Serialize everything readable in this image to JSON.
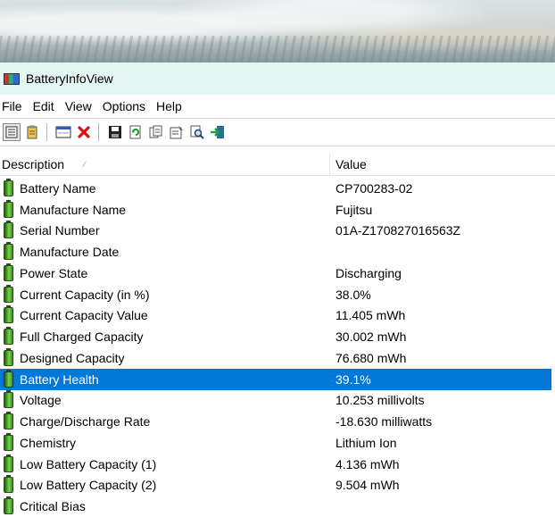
{
  "window": {
    "title": "BatteryInfoView"
  },
  "menu": [
    "File",
    "Edit",
    "View",
    "Options",
    "Help"
  ],
  "toolbar": [
    {
      "icon": "list-view-icon",
      "glyph": "☰",
      "pressed": true
    },
    {
      "icon": "clipboard-icon",
      "glyph": "📋",
      "pressed": false
    },
    {
      "icon": "window-icon",
      "glyph": "▭",
      "pressed": false
    },
    {
      "icon": "delete-icon",
      "glyph": "✕",
      "pressed": false
    },
    {
      "icon": "save-icon",
      "glyph": "💾",
      "pressed": false
    },
    {
      "icon": "refresh-icon",
      "glyph": "⟳",
      "pressed": false
    },
    {
      "icon": "copy-icon",
      "glyph": "⧉",
      "pressed": false
    },
    {
      "icon": "properties-icon",
      "glyph": "🗎",
      "pressed": false
    },
    {
      "icon": "find-icon",
      "glyph": "🔍",
      "pressed": false
    },
    {
      "icon": "exit-icon",
      "glyph": "⇥",
      "pressed": false
    }
  ],
  "columns": {
    "description": "Description",
    "value": "Value"
  },
  "rows": [
    {
      "description": "Battery Name",
      "value": "CP700283-02"
    },
    {
      "description": "Manufacture Name",
      "value": "Fujitsu"
    },
    {
      "description": "Serial Number",
      "value": "01A-Z170827016563Z"
    },
    {
      "description": "Manufacture Date",
      "value": ""
    },
    {
      "description": "Power State",
      "value": "Discharging"
    },
    {
      "description": "Current Capacity (in %)",
      "value": "38.0%"
    },
    {
      "description": "Current Capacity Value",
      "value": "11.405 mWh"
    },
    {
      "description": "Full Charged Capacity",
      "value": "30.002 mWh"
    },
    {
      "description": "Designed Capacity",
      "value": "76.680 mWh"
    },
    {
      "description": "Battery Health",
      "value": "39.1%",
      "selected": true
    },
    {
      "description": "Voltage",
      "value": "10.253 millivolts"
    },
    {
      "description": "Charge/Discharge Rate",
      "value": "-18.630 milliwatts"
    },
    {
      "description": "Chemistry",
      "value": "Lithium Ion"
    },
    {
      "description": "Low Battery Capacity (1)",
      "value": "4.136 mWh"
    },
    {
      "description": "Low Battery Capacity (2)",
      "value": "9.504 mWh"
    },
    {
      "description": "Critical Bias",
      "value": ""
    }
  ],
  "colors": {
    "selection": "#0078d7",
    "titlebar": "#e3f6f2"
  }
}
